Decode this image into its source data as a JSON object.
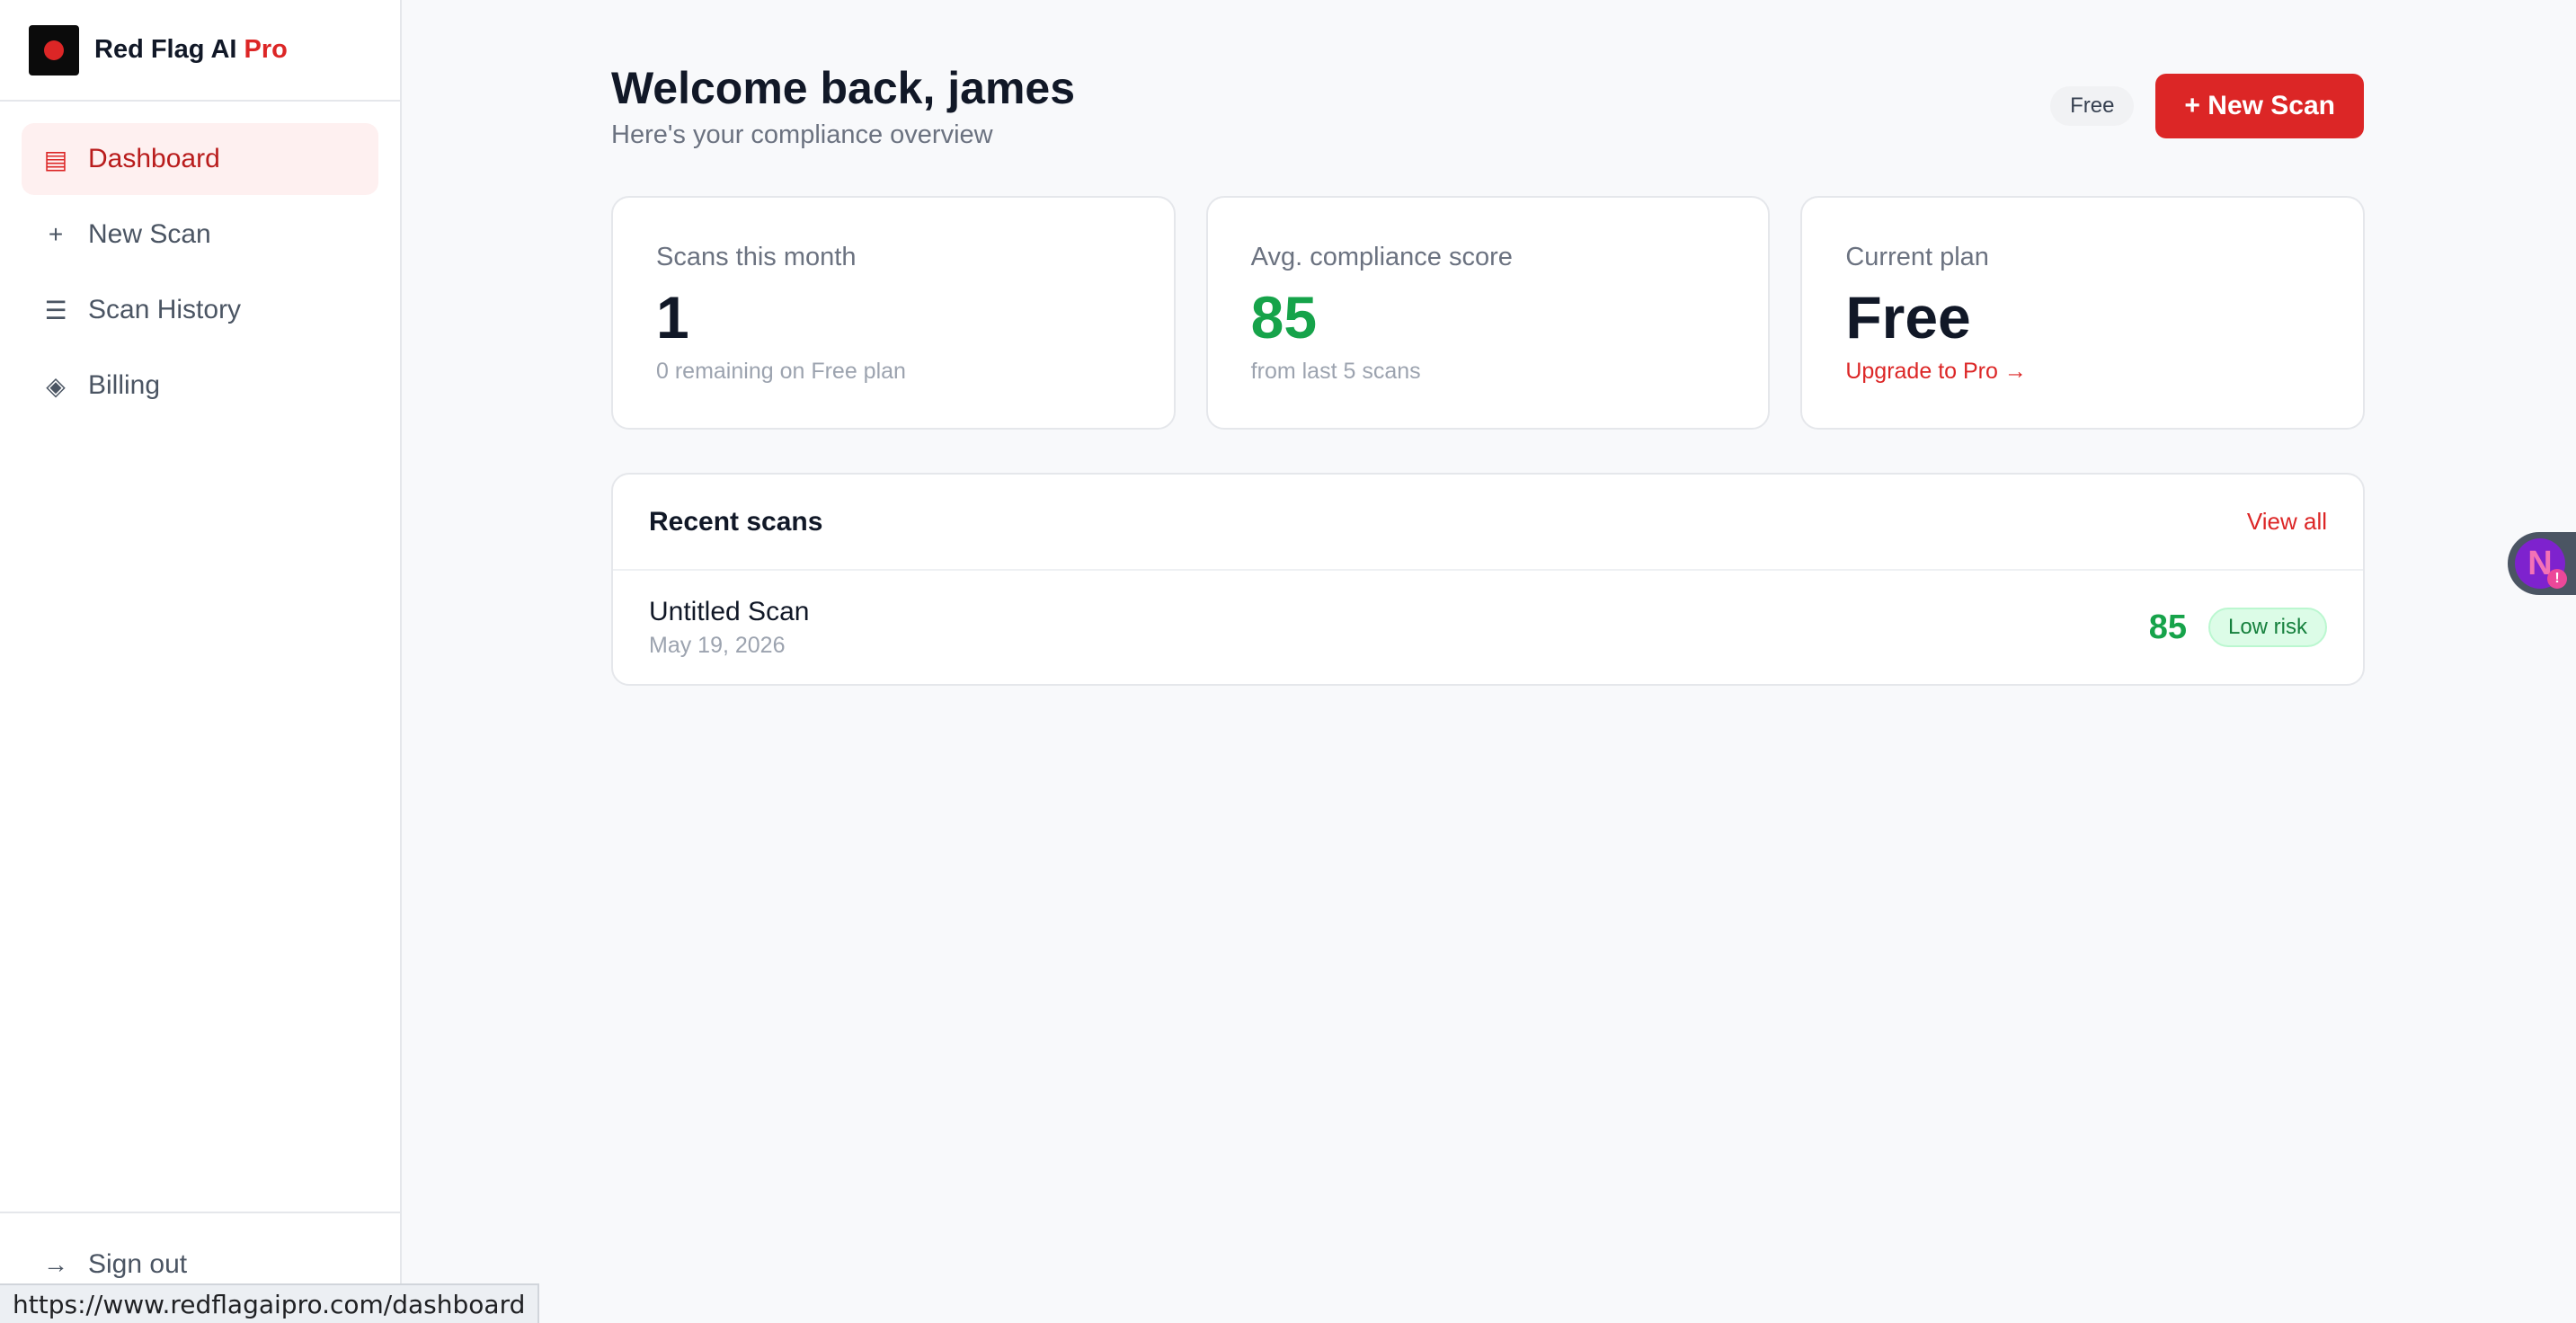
{
  "brand": {
    "name": "Red Flag AI",
    "pro": "Pro"
  },
  "sidebar": {
    "items": [
      {
        "label": "Dashboard",
        "icon": "dashboard-icon"
      },
      {
        "label": "New Scan",
        "icon": "plus-icon"
      },
      {
        "label": "Scan History",
        "icon": "list-icon"
      },
      {
        "label": "Billing",
        "icon": "diamond-icon"
      }
    ],
    "signout": "Sign out"
  },
  "header": {
    "title": "Welcome back, james",
    "subtitle": "Here's your compliance overview",
    "plan_badge": "Free",
    "new_scan_label": "+ New Scan"
  },
  "stats": [
    {
      "label": "Scans this month",
      "value": "1",
      "note": "0 remaining on Free plan"
    },
    {
      "label": "Avg. compliance score",
      "value": "85",
      "note": "from last 5 scans"
    },
    {
      "label": "Current plan",
      "value": "Free",
      "link": "Upgrade to Pro →"
    }
  ],
  "recent": {
    "title": "Recent scans",
    "view_all": "View all",
    "rows": [
      {
        "name": "Untitled Scan",
        "date": "May 19, 2026",
        "score": "85",
        "risk": "Low risk"
      }
    ]
  },
  "status_url": "https://www.redflagaipro.com/dashboard",
  "colors": {
    "accent": "#dc2626",
    "success": "#16a34a"
  }
}
